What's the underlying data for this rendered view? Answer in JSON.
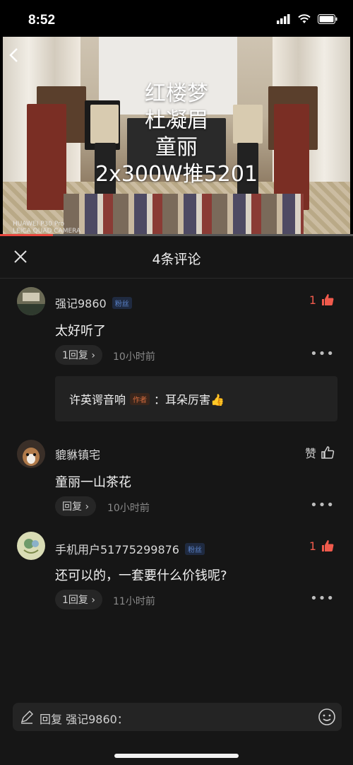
{
  "status_bar": {
    "time": "8:52"
  },
  "video": {
    "overlay_lines": [
      "红楼梦",
      "杜凝眉",
      "童丽",
      "2x300W推5201"
    ],
    "watermark": [
      "HUAWEI P30 Pro",
      "LEICA QUAD CAMERA"
    ],
    "progress": 0.15
  },
  "comments_header": {
    "title": "4条评论"
  },
  "comments": [
    {
      "username": "强记9860",
      "badge": "粉丝",
      "text": "太好听了",
      "reply_label": "1回复 ›",
      "time": "10小时前",
      "like_count": "1",
      "like_active": true,
      "sub_reply": {
        "author": "许英谔音响",
        "author_tag": "作者",
        "text": "：耳朵厉害👍"
      }
    },
    {
      "username": "貔貅镇宅",
      "text": "童丽一山茶花",
      "reply_label": "回复 ›",
      "time": "10小时前",
      "like_label": "赞",
      "like_active": false
    },
    {
      "username": "手机用户51775299876",
      "badge": "粉丝",
      "text": "还可以的，一套要什么价钱呢?",
      "reply_label": "1回复 ›",
      "time": "11小时前",
      "like_count": "1",
      "like_active": true
    }
  ],
  "input": {
    "placeholder": "回复 强记9860："
  },
  "colors": {
    "accent": "#f05a4c",
    "background": "#161616"
  },
  "icons": [
    "back-arrow-icon",
    "close-icon",
    "thumbs-up-icon",
    "more-icon",
    "pen-icon",
    "emoji-icon",
    "signal-icon",
    "wifi-icon",
    "battery-icon"
  ]
}
